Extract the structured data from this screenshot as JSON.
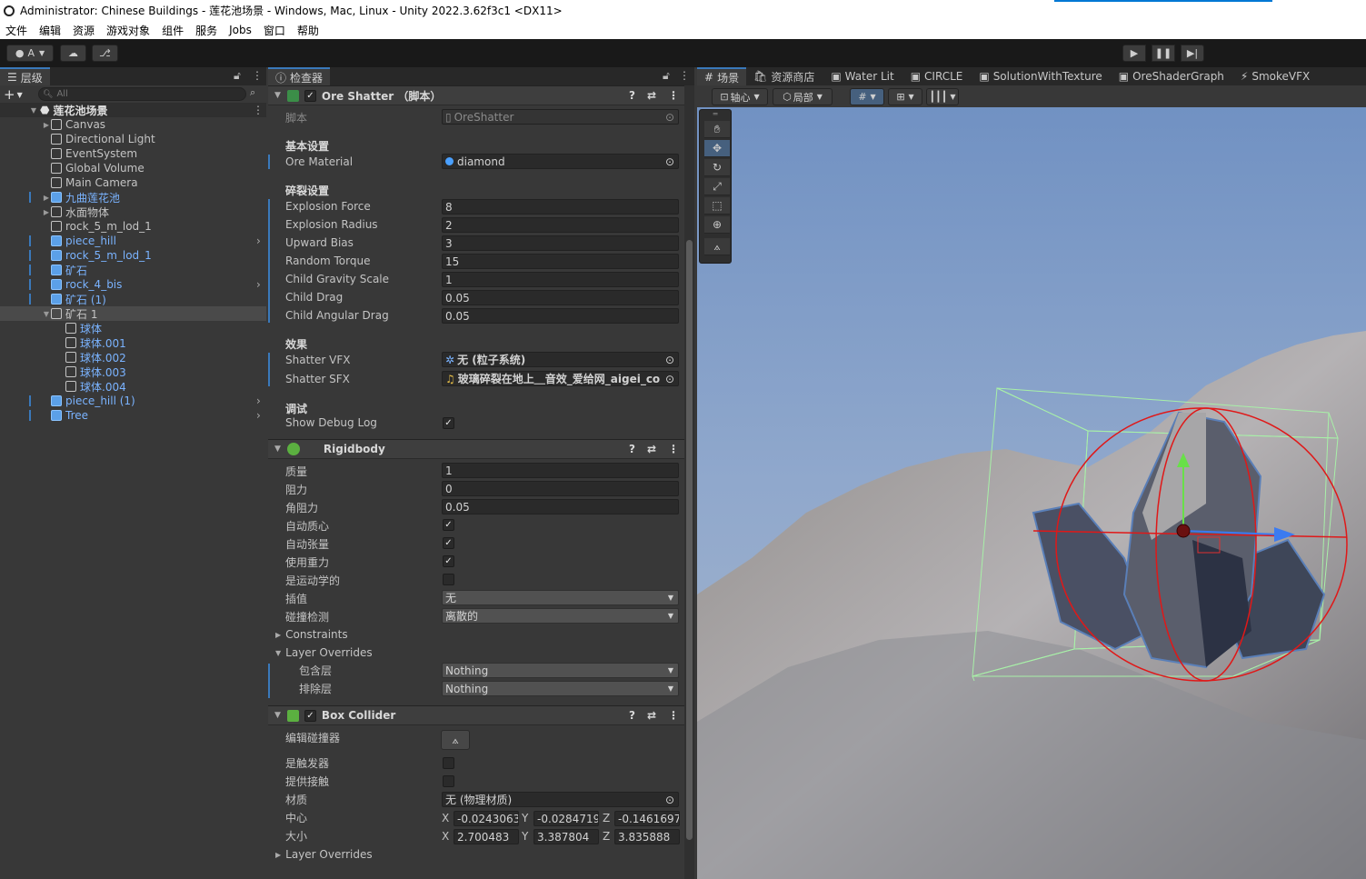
{
  "titlebar": {
    "title": "Administrator: Chinese Buildings - 莲花池场景 - Windows, Mac, Linux - Unity 2022.3.62f3c1 <DX11>"
  },
  "menu": [
    "文件",
    "编辑",
    "资源",
    "游戏对象",
    "组件",
    "服务",
    "Jobs",
    "窗口",
    "帮助"
  ],
  "toolbar": {
    "account_label": "A"
  },
  "hierarchy": {
    "tab": "层级",
    "search_placeholder": "All",
    "scene_name": "莲花池场景",
    "items": [
      {
        "label": "Canvas",
        "depth": 1,
        "fold": "closed",
        "prefab": false
      },
      {
        "label": "Directional Light",
        "depth": 1,
        "fold": "none",
        "prefab": false
      },
      {
        "label": "EventSystem",
        "depth": 1,
        "fold": "none",
        "prefab": false
      },
      {
        "label": "Global Volume",
        "depth": 1,
        "fold": "none",
        "prefab": false
      },
      {
        "label": "Main Camera",
        "depth": 1,
        "fold": "none",
        "prefab": false
      },
      {
        "label": "九曲莲花池",
        "depth": 1,
        "fold": "closed",
        "prefab": true
      },
      {
        "label": "水面物体",
        "depth": 1,
        "fold": "closed",
        "prefab": false
      },
      {
        "label": "rock_5_m_lod_1",
        "depth": 1,
        "fold": "none",
        "prefab": false
      },
      {
        "label": "piece_hill",
        "depth": 1,
        "fold": "none",
        "prefab": true
      },
      {
        "label": "rock_5_m_lod_1",
        "depth": 1,
        "fold": "none",
        "prefab": true
      },
      {
        "label": "矿石",
        "depth": 1,
        "fold": "none",
        "prefab": true
      },
      {
        "label": "rock_4_bis",
        "depth": 1,
        "fold": "none",
        "prefab": true
      },
      {
        "label": "矿石 (1)",
        "depth": 1,
        "fold": "none",
        "prefab": true
      },
      {
        "label": "矿石 1",
        "depth": 1,
        "fold": "open",
        "prefab": false,
        "selected": true
      },
      {
        "label": "球体",
        "depth": 2,
        "fold": "none",
        "prefab": false,
        "blue": true
      },
      {
        "label": "球体.001",
        "depth": 2,
        "fold": "none",
        "prefab": false,
        "blue": true
      },
      {
        "label": "球体.002",
        "depth": 2,
        "fold": "none",
        "prefab": false,
        "blue": true
      },
      {
        "label": "球体.003",
        "depth": 2,
        "fold": "none",
        "prefab": false,
        "blue": true
      },
      {
        "label": "球体.004",
        "depth": 2,
        "fold": "none",
        "prefab": false,
        "blue": true
      },
      {
        "label": "piece_hill (1)",
        "depth": 1,
        "fold": "none",
        "prefab": true
      },
      {
        "label": "Tree",
        "depth": 1,
        "fold": "none",
        "prefab": true
      }
    ]
  },
  "inspector": {
    "tab": "检查器",
    "ore": {
      "title": "Ore Shatter （脚本）",
      "script_label": "脚本",
      "script_value": "OreShatter",
      "basic_header": "基本设置",
      "ore_material_label": "Ore Material",
      "ore_material_value": "diamond",
      "shatter_header": "碎裂设置",
      "fields": [
        {
          "label": "Explosion Force",
          "value": "8"
        },
        {
          "label": "Explosion Radius",
          "value": "2"
        },
        {
          "label": "Upward Bias",
          "value": "3"
        },
        {
          "label": "Random Torque",
          "value": "15"
        },
        {
          "label": "Child Gravity Scale",
          "value": "1"
        },
        {
          "label": "Child Drag",
          "value": "0.05"
        },
        {
          "label": "Child Angular Drag",
          "value": "0.05"
        }
      ],
      "effects_header": "效果",
      "vfx_label": "Shatter VFX",
      "vfx_value": "无 (粒子系统)",
      "sfx_label": "Shatter SFX",
      "sfx_value": "玻璃碎裂在地上＿音效_爱给网_aigei_co",
      "debug_header": "调试",
      "debug_label": "Show Debug Log"
    },
    "rigidbody": {
      "title": "Rigidbody",
      "mass_label": "质量",
      "mass": "1",
      "drag_label": "阻力",
      "drag": "0",
      "angdrag_label": "角阻力",
      "angdrag": "0.05",
      "auto_com": "自动质心",
      "auto_tensor": "自动张量",
      "use_gravity": "使用重力",
      "kinematic": "是运动学的",
      "interp_label": "插值",
      "interp": "无",
      "collision_label": "碰撞检测",
      "collision": "离散的",
      "constraints": "Constraints",
      "layer_overrides": "Layer Overrides",
      "include_label": "包含层",
      "include": "Nothing",
      "exclude_label": "排除层",
      "exclude": "Nothing"
    },
    "box": {
      "title": "Box Collider",
      "edit_label": "编辑碰撞器",
      "trigger": "是触发器",
      "contacts": "提供接触",
      "material_label": "材质",
      "material": "无 (物理材质)",
      "center_label": "中心",
      "center": {
        "x": "-0.0243063",
        "y": "-0.0284719",
        "z": "-0.1461697"
      },
      "size_label": "大小",
      "size": {
        "x": "2.700483",
        "y": "3.387804",
        "z": "3.835888"
      },
      "layer_overrides": "Layer Overrides"
    }
  },
  "scene_tabs": [
    "场景",
    "资源商店",
    "Water Lit",
    "CIRCLE",
    "SolutionWithTexture",
    "OreShaderGraph",
    "SmokeVFX"
  ],
  "scene_toolbar": {
    "pivot": "轴心",
    "local": "局部"
  },
  "axis_labels": {
    "x": "X",
    "y": "Y",
    "z": "Z"
  }
}
